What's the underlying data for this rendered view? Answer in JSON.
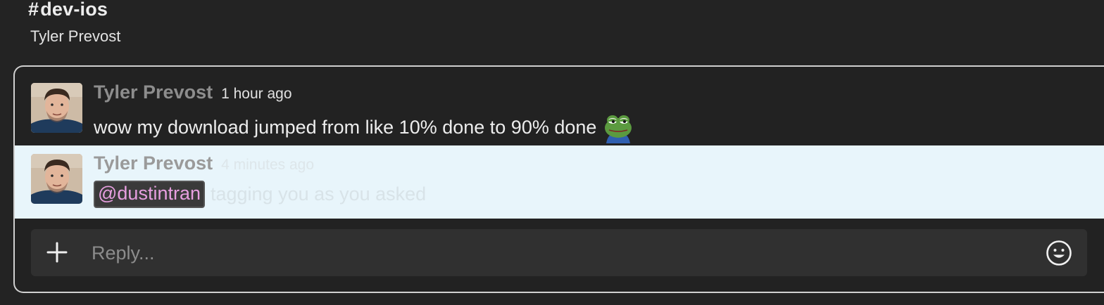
{
  "header": {
    "channel_prefix": "#",
    "channel_name": "dev-ios",
    "subtitle": "Tyler Prevost"
  },
  "thread": {
    "messages": [
      {
        "author": "Tyler Prevost",
        "timestamp": "1 hour ago",
        "text": "wow my download jumped from like 10% done to 90% done",
        "emoji": "pepe-frog-emoji"
      },
      {
        "author": "Tyler Prevost",
        "timestamp": "4 minutes ago",
        "mention": "@dustintran",
        "text": "tagging you as you asked",
        "highlighted": true
      }
    ]
  },
  "reply": {
    "placeholder": "Reply...",
    "value": "",
    "add_icon": "plus-icon",
    "emoji_icon": "smiley-icon"
  },
  "colors": {
    "background": "#232323",
    "highlight": "#e8f5fb",
    "mention_text": "#e79fe0",
    "panel_border": "#d0d0d0"
  }
}
